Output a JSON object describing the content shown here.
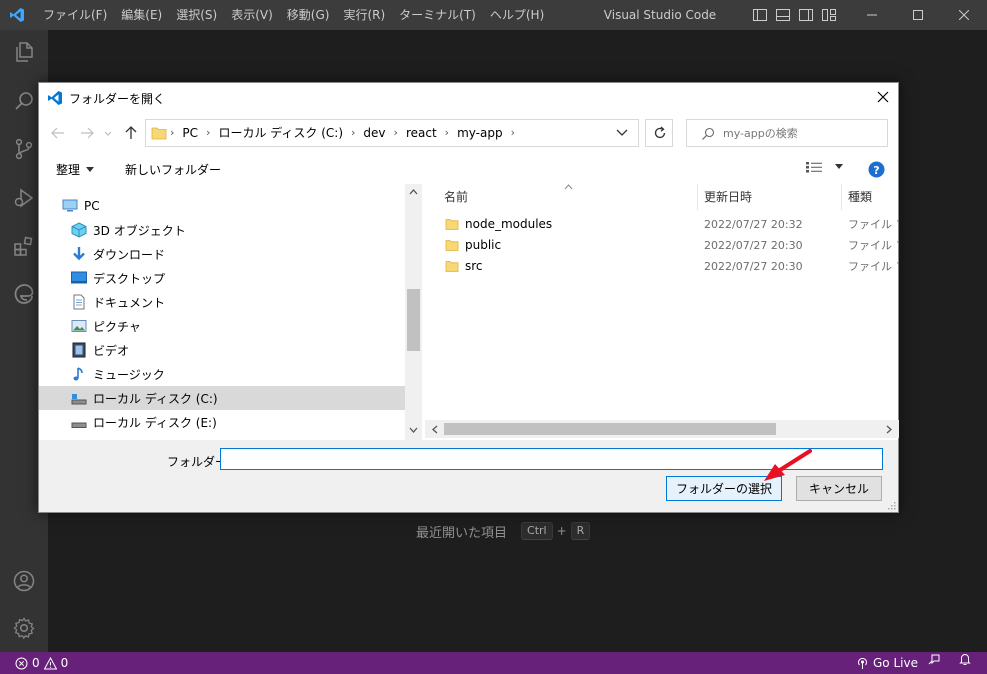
{
  "window": {
    "title": "Visual Studio Code",
    "menu": [
      "ファイル(F)",
      "編集(E)",
      "選択(S)",
      "表示(V)",
      "移動(G)",
      "実行(R)",
      "ターミナル(T)",
      "ヘルプ(H)"
    ]
  },
  "editor": {
    "recent_label": "最近開いた項目",
    "shortcut_key1": "Ctrl",
    "shortcut_plus": "+",
    "shortcut_key2": "R"
  },
  "statusbar": {
    "errors": "0",
    "warnings": "0",
    "go_live": "Go Live",
    "color": "#68217a"
  },
  "dialog": {
    "title": "フォルダーを開く",
    "breadcrumbs": [
      "PC",
      "ローカル ディスク (C:)",
      "dev",
      "react",
      "my-app"
    ],
    "search_placeholder": "my-appの検索",
    "toolbar": {
      "organize": "整理",
      "new_folder": "新しいフォルダー"
    },
    "nav_items": [
      {
        "label": "PC",
        "icon": "pc-icon"
      },
      {
        "label": "3D オブジェクト",
        "icon": "3d-objects-icon"
      },
      {
        "label": "ダウンロード",
        "icon": "download-icon"
      },
      {
        "label": "デスクトップ",
        "icon": "desktop-icon"
      },
      {
        "label": "ドキュメント",
        "icon": "documents-icon"
      },
      {
        "label": "ピクチャ",
        "icon": "pictures-icon"
      },
      {
        "label": "ビデオ",
        "icon": "videos-icon"
      },
      {
        "label": "ミュージック",
        "icon": "music-icon"
      },
      {
        "label": "ローカル ディスク (C:)",
        "icon": "drive-icon",
        "selected": true
      },
      {
        "label": "ローカル ディスク (E:)",
        "icon": "drive-icon"
      }
    ],
    "columns": {
      "name": "名前",
      "modified": "更新日時",
      "type": "種類"
    },
    "files": [
      {
        "name": "node_modules",
        "modified": "2022/07/27 20:32",
        "type": "ファイル フォルダー"
      },
      {
        "name": "public",
        "modified": "2022/07/27 20:30",
        "type": "ファイル フォルダー"
      },
      {
        "name": "src",
        "modified": "2022/07/27 20:30",
        "type": "ファイル フォルダー"
      }
    ],
    "folder_label": "フォルダー:",
    "folder_value": "",
    "select_button": "フォルダーの選択",
    "cancel_button": "キャンセル",
    "annotation_arrow_color": "#e81123"
  }
}
